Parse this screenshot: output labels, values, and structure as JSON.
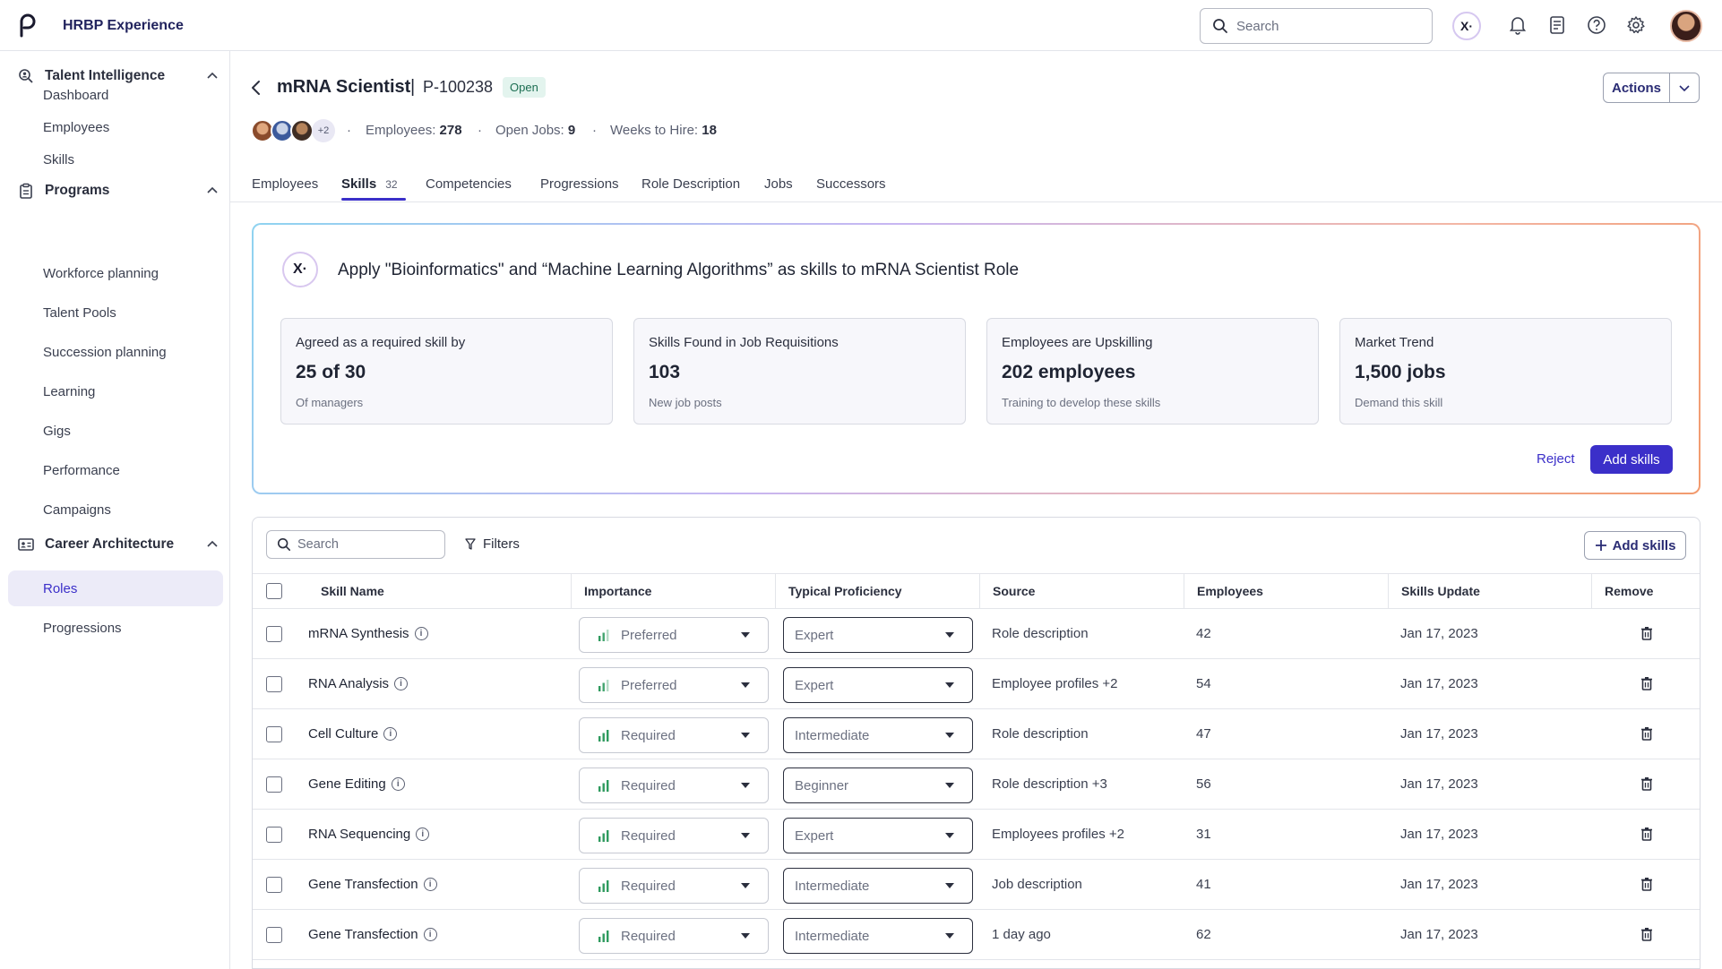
{
  "app": {
    "title": "HRBP Experience"
  },
  "topbar": {
    "search_placeholder": "Search"
  },
  "sidebar": {
    "sections": [
      {
        "label": "Talent Intelligence",
        "items": [
          "Dashboard",
          "Employees",
          "Skills"
        ]
      },
      {
        "label": "Programs",
        "items": [
          "Workforce planning",
          "Talent Pools",
          "Succession planning",
          "Learning",
          "Gigs",
          "Performance",
          "Campaigns"
        ]
      },
      {
        "label": "Career Architecture",
        "items": [
          "Roles",
          "Progressions"
        ]
      }
    ],
    "active_item": "Roles"
  },
  "header": {
    "title": "mRNA Scientist",
    "separator": "|",
    "id": "P-100238",
    "status": "Open",
    "actions_label": "Actions",
    "avatars_more": "+2",
    "employees_label": "Employees:",
    "employees_value": "278",
    "open_jobs_label": "Open Jobs:",
    "open_jobs_value": "9",
    "weeks_label": "Weeks to Hire:",
    "weeks_value": "18"
  },
  "tabs": [
    {
      "label": "Employees"
    },
    {
      "label": "Skills",
      "count": "32",
      "active": true
    },
    {
      "label": "Competencies"
    },
    {
      "label": "Progressions"
    },
    {
      "label": "Role Description"
    },
    {
      "label": "Jobs"
    },
    {
      "label": "Successors"
    }
  ],
  "suggestion": {
    "icon_text": "X·",
    "title": "Apply \"Bioinformatics\" and “Machine Learning Algorithms” as skills to mRNA Scientist Role",
    "stats": [
      {
        "heading": "Agreed as a required skill by",
        "value": "25 of 30",
        "sub": "Of managers"
      },
      {
        "heading": "Skills Found in Job Requisitions",
        "value": "103",
        "sub": "New job posts"
      },
      {
        "heading": "Employees are Upskilling",
        "value": "202 employees",
        "sub": "Training to develop these skills"
      },
      {
        "heading": "Market Trend",
        "value": "1,500 jobs",
        "sub": "Demand this skill"
      }
    ],
    "reject_label": "Reject",
    "add_label": "Add skills"
  },
  "table": {
    "search_placeholder": "Search",
    "filters_label": "Filters",
    "add_label": "Add skills",
    "columns": [
      "Skill Name",
      "Importance",
      "Typical Proficiency",
      "Source",
      "Employees",
      "Skills Update",
      "Remove"
    ],
    "rows": [
      {
        "skill": "mRNA Synthesis",
        "importance": "Preferred",
        "proficiency": "Expert",
        "source": "Role description",
        "employees": "42",
        "updated": "Jan 17, 2023"
      },
      {
        "skill": "RNA Analysis",
        "importance": "Preferred",
        "proficiency": "Expert",
        "source": "Employee profiles +2",
        "employees": "54",
        "updated": "Jan 17, 2023"
      },
      {
        "skill": "Cell Culture",
        "importance": "Required",
        "proficiency": "Intermediate",
        "source": "Role description",
        "employees": "47",
        "updated": "Jan 17, 2023"
      },
      {
        "skill": "Gene Editing",
        "importance": "Required",
        "proficiency": "Beginner",
        "source": "Role description +3",
        "employees": "56",
        "updated": "Jan 17, 2023"
      },
      {
        "skill": "RNA Sequencing",
        "importance": "Required",
        "proficiency": "Expert",
        "source": "Employees profiles +2",
        "employees": "31",
        "updated": "Jan 17, 2023"
      },
      {
        "skill": "Gene Transfection",
        "importance": "Required",
        "proficiency": "Intermediate",
        "source": "Job description",
        "employees": "41",
        "updated": "Jan 17, 2023"
      },
      {
        "skill": "Gene Transfection",
        "importance": "Required",
        "proficiency": "Intermediate",
        "source": "1 day ago",
        "employees": "62",
        "updated": "Jan 17, 2023"
      }
    ]
  },
  "colors": {
    "accent": "#3b2fc9",
    "brand_dark": "#22245e",
    "importance_bars": "#2e9a5e"
  }
}
